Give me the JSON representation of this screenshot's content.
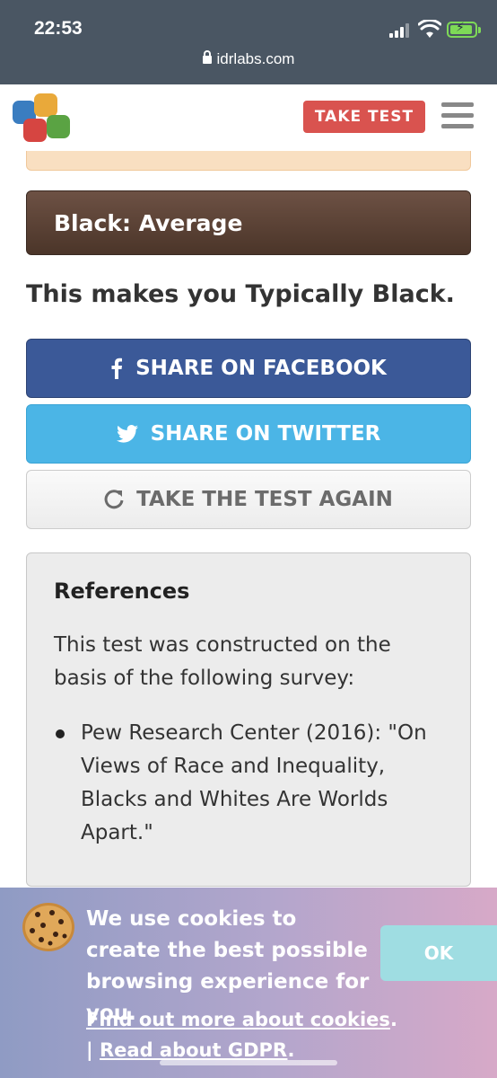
{
  "status_bar": {
    "time": "22:53",
    "url": "idrlabs.com"
  },
  "header": {
    "take_test_label": "TAKE TEST",
    "logo_colors": [
      "#3a7dc0",
      "#e9a93a",
      "#d64541",
      "#5aa343"
    ]
  },
  "result": {
    "bar_label": "Black: Average",
    "bar_color": "#5a4033",
    "summary": "This makes you Typically Black."
  },
  "buttons": {
    "facebook": "SHARE ON FACEBOOK",
    "twitter": "SHARE ON TWITTER",
    "again": "TAKE THE TEST AGAIN"
  },
  "references": {
    "title": "References",
    "intro": "This test was constructed on the basis of the following survey:",
    "items": [
      "Pew Research Center (2016): \"On Views of Race and Inequality, Blacks and Whites Are Worlds Apart.\""
    ]
  },
  "cookie_banner": {
    "message": "We use cookies to create the best possible browsing experience for you.",
    "ok_label": "OK",
    "link_cookies": "Find out more about cookies",
    "link_gdpr": "Read about GDPR",
    "separator": "|"
  },
  "colors": {
    "facebook": "#3b5998",
    "twitter": "#4bb5e6",
    "take_test": "#d9534f"
  },
  "icons": [
    "lock-icon",
    "facebook-icon",
    "twitter-icon",
    "refresh-icon",
    "cookie-icon",
    "menu-icon"
  ]
}
